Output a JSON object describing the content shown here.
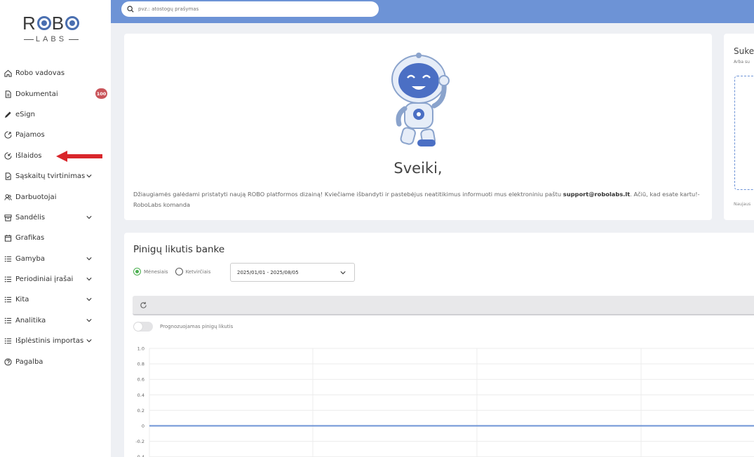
{
  "logo": {
    "top": "ROBO",
    "sub": "LABS"
  },
  "search": {
    "placeholder": "pvz.: atostogų prašymas"
  },
  "sidebar": {
    "items": [
      {
        "label": "Robo vadovas",
        "icon": "home-icon"
      },
      {
        "label": "Dokumentai",
        "icon": "document-icon",
        "badge": "100"
      },
      {
        "label": "eSign",
        "icon": "pen-icon"
      },
      {
        "label": "Pajamos",
        "icon": "income-icon"
      },
      {
        "label": "Išlaidos",
        "icon": "expense-icon"
      },
      {
        "label": "Sąskaitų tvirtinimas",
        "icon": "invoice-check-icon",
        "chevron": true
      },
      {
        "label": "Darbuotojai",
        "icon": "users-icon"
      },
      {
        "label": "Sandėlis",
        "icon": "warehouse-icon",
        "chevron": true
      },
      {
        "label": "Grafikas",
        "icon": "calendar-icon"
      },
      {
        "label": "Gamyba",
        "icon": "list-icon",
        "chevron": true
      },
      {
        "label": "Periodiniai įrašai",
        "icon": "list-icon",
        "chevron": true
      },
      {
        "label": "Kita",
        "icon": "list-icon",
        "chevron": true
      },
      {
        "label": "Analitika",
        "icon": "list-icon",
        "chevron": true
      },
      {
        "label": "Išplėstinis importas",
        "icon": "list-icon",
        "chevron": true
      },
      {
        "label": "Pagalba",
        "icon": "help-icon"
      }
    ]
  },
  "welcome": {
    "title": "Sveiki,",
    "text_before": "Džiaugiamės galėdami pristatyti naują ROBO platformos dizainą! Kviečiame išbandyti ir pastebėjus neatitikimus informuoti mus elektroniniu paštu ",
    "email": "support@robolabs.lt",
    "text_after": ". Ačiū, kad esate kartu!- RoboLabs komanda"
  },
  "side_card": {
    "title": "Suke",
    "subtitle": "Arba su",
    "footer": "Naujaus"
  },
  "balance": {
    "title": "Pinigų likutis banke",
    "radio_monthly": "Mėnesiais",
    "radio_quarterly": "Ketvirčiais",
    "date_range": "2025/01/01 - 2025/08/05",
    "toggle_label": "Prognozuojamas pinigų likutis"
  },
  "colors": {
    "accent": "#6d93d6",
    "badge": "#c9545a",
    "radio_on": "#4caf50",
    "arrow": "#d9262b"
  },
  "chart_data": {
    "type": "line",
    "yticks": [
      "1.0",
      "0.8",
      "0.6",
      "0.4",
      "0.2",
      "0",
      "-0.2",
      "-0.4"
    ],
    "ylim": [
      -0.4,
      1.0
    ],
    "series": [
      {
        "values": [
          0,
          0,
          0,
          0,
          0
        ]
      }
    ],
    "color": "#6d93d6",
    "grid": true
  }
}
